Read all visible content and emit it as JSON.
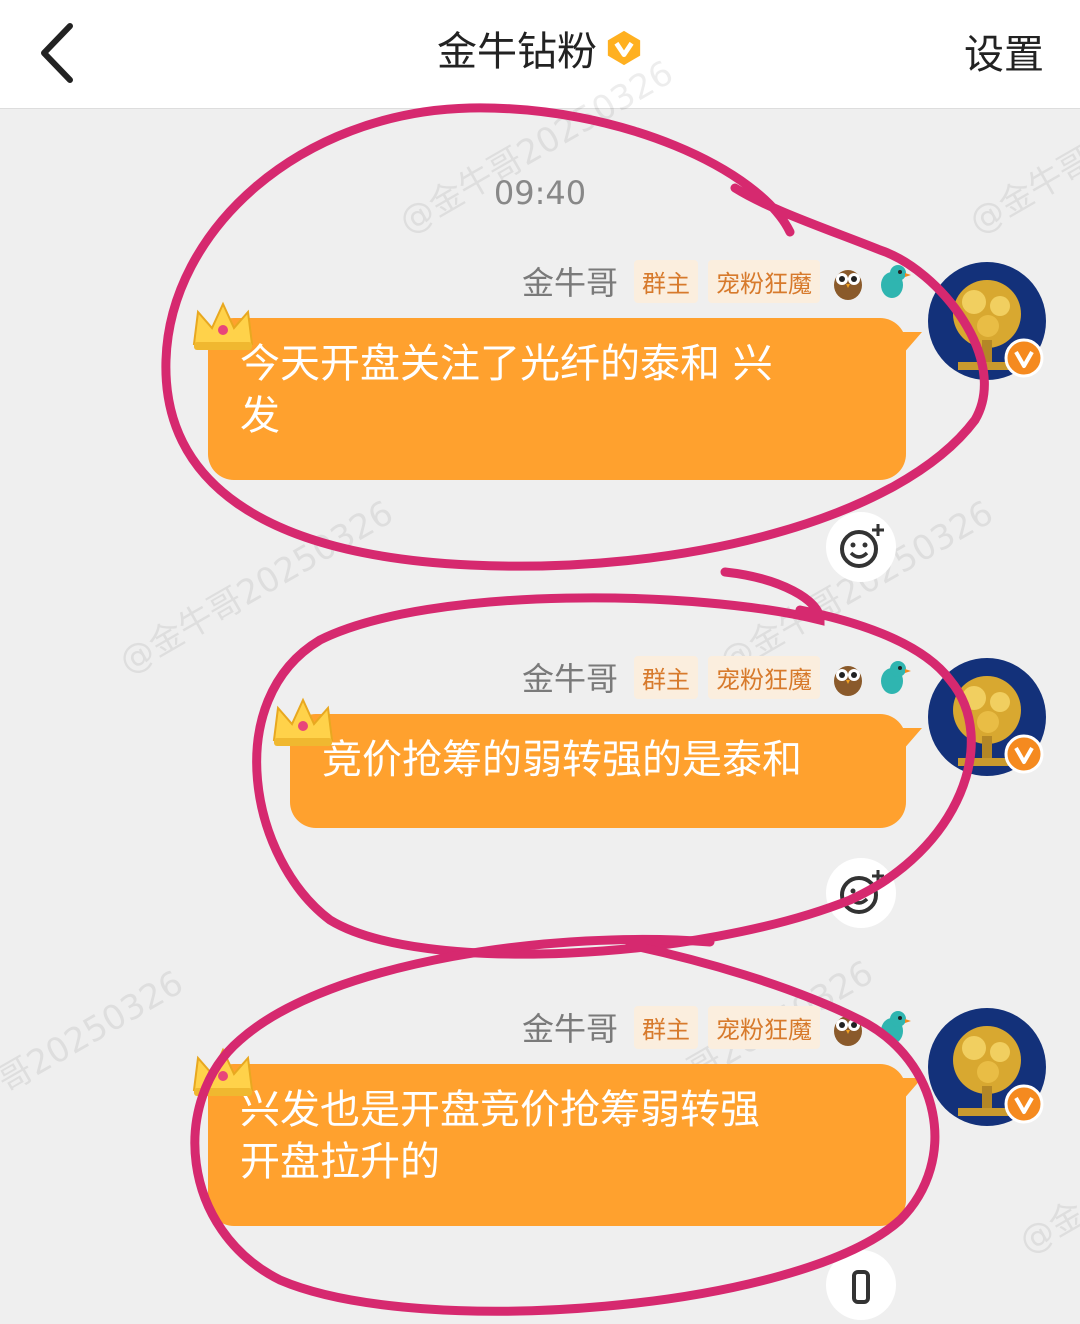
{
  "header": {
    "title": "金牛钻粉",
    "settings_label": "设置"
  },
  "watermark_text": "@金牛哥20250326",
  "time_stamp": "09:40",
  "messages": [
    {
      "sender": "金牛哥",
      "tags": [
        "群主",
        "宠粉狂魔"
      ],
      "text_line1": "今天开盘关注了光纤的泰和 兴",
      "text_line2": "发"
    },
    {
      "sender": "金牛哥",
      "tags": [
        "群主",
        "宠粉狂魔"
      ],
      "text_line1": "竞价抢筹的弱转强的是泰和"
    },
    {
      "sender": "金牛哥",
      "tags": [
        "群主",
        "宠粉狂魔"
      ],
      "text_line1": "兴发也是开盘竞价抢筹弱转强",
      "text_line2": "开盘拉升的"
    }
  ],
  "colors": {
    "bubble": "#ffa12e",
    "annotation": "#d6296f",
    "tag_text": "#d77a2c"
  },
  "icons": [
    "back-arrow-icon",
    "vip-badge-icon",
    "owl-icon",
    "bird-icon",
    "crown-icon",
    "emoji-add-icon",
    "verified-badge-icon"
  ]
}
